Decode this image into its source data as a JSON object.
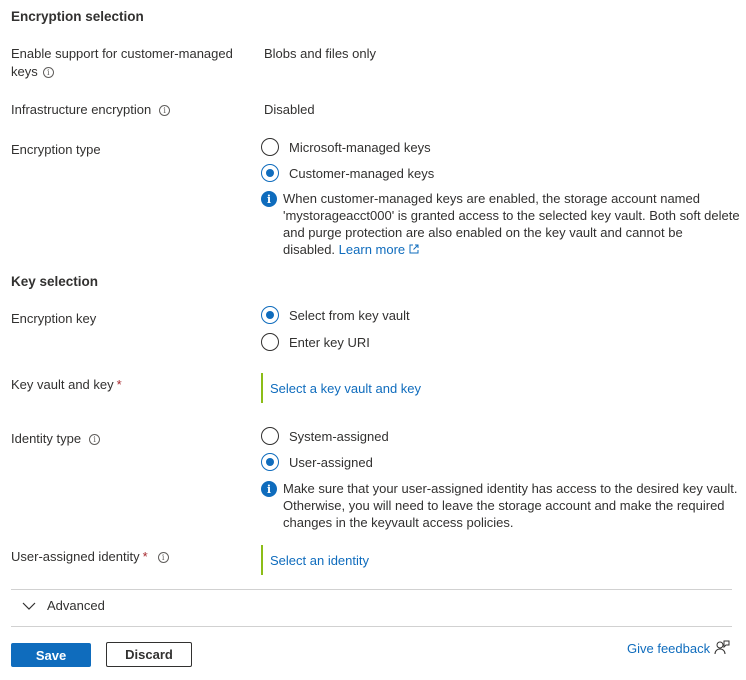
{
  "encryption_section": {
    "title": "Encryption selection",
    "cmk_support": {
      "label_line1": "Enable support for customer-managed",
      "label_line2": "keys",
      "value": "Blobs and files only"
    },
    "infrastructure": {
      "label": "Infrastructure encryption",
      "value": "Disabled"
    },
    "encryption_type": {
      "label": "Encryption type",
      "options": [
        "Microsoft-managed keys",
        "Customer-managed keys"
      ],
      "selected": "Customer-managed keys",
      "note_lines": [
        "When customer-managed keys are enabled, the storage account named",
        "'mystorageacct000' is granted access to the selected key vault. Both soft delete",
        "and purge protection are also enabled on the key vault and cannot be"
      ],
      "note_last": "disabled.",
      "learn_more": "Learn more"
    }
  },
  "key_section": {
    "title": "Key selection",
    "encryption_key": {
      "label": "Encryption key",
      "options": [
        "Select from key vault",
        "Enter key URI"
      ],
      "selected": "Select from key vault"
    },
    "key_vault": {
      "label": "Key vault and key",
      "required": "*",
      "link": "Select a key vault and key"
    },
    "identity_type": {
      "label": "Identity type",
      "options": [
        "System-assigned",
        "User-assigned"
      ],
      "selected": "User-assigned",
      "note_lines": [
        "Make sure that your user-assigned identity has access to the desired key vault.",
        "Otherwise, you will need to leave the storage account and make the required",
        "changes in the keyvault access policies."
      ]
    },
    "user_identity": {
      "label": "User-assigned identity",
      "required": "*",
      "link": "Select an identity"
    }
  },
  "advanced": {
    "label": "Advanced"
  },
  "footer": {
    "save": "Save",
    "discard": "Discard",
    "feedback": "Give feedback"
  },
  "colors": {
    "accent": "#0f6cbd",
    "required": "#a4262c",
    "picker_border": "#8cbd18"
  },
  "icons": {
    "info": "info-icon",
    "note": "info-filled-icon",
    "chevron": "chevron-down-icon",
    "external": "external-link-icon",
    "feedback": "feedback-person-icon"
  }
}
